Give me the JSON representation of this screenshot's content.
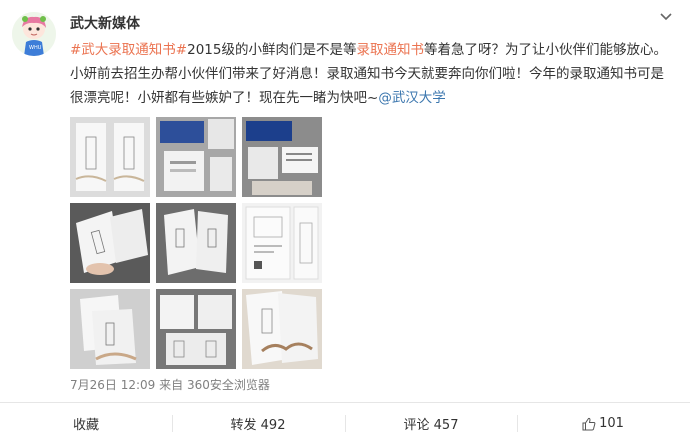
{
  "post": {
    "author": "武大新媒体",
    "text_parts": {
      "topic_1": "#武大录取通知书#",
      "part_1": "2015级的小鲜肉们是不是等",
      "highlight": "录取通知书",
      "part_2": "等着急了呀？为了让小伙伴们能够放心。小妍前去招生办帮小伙伴们带来了好消息！录取通知书今天就要奔向你们啦！今年的录取通知书可是很漂亮呢！小妍都有些嫉妒了！现在先一睹为快吧~",
      "mention": "@武汉大学"
    },
    "timestamp": "7月26日 12:09",
    "source": "来自 360安全浏览器"
  },
  "actions": {
    "favorite": "收藏",
    "repost": "转发 492",
    "comment": "评论 457",
    "like_count": "101"
  },
  "colors": {
    "topic": "#eb7350",
    "mention": "#3b76ae",
    "meta": "#808080"
  },
  "icons": {
    "avatar": "cartoon-girl-avatar",
    "menu": "chevron-down-icon",
    "like": "thumbs-up-icon"
  }
}
